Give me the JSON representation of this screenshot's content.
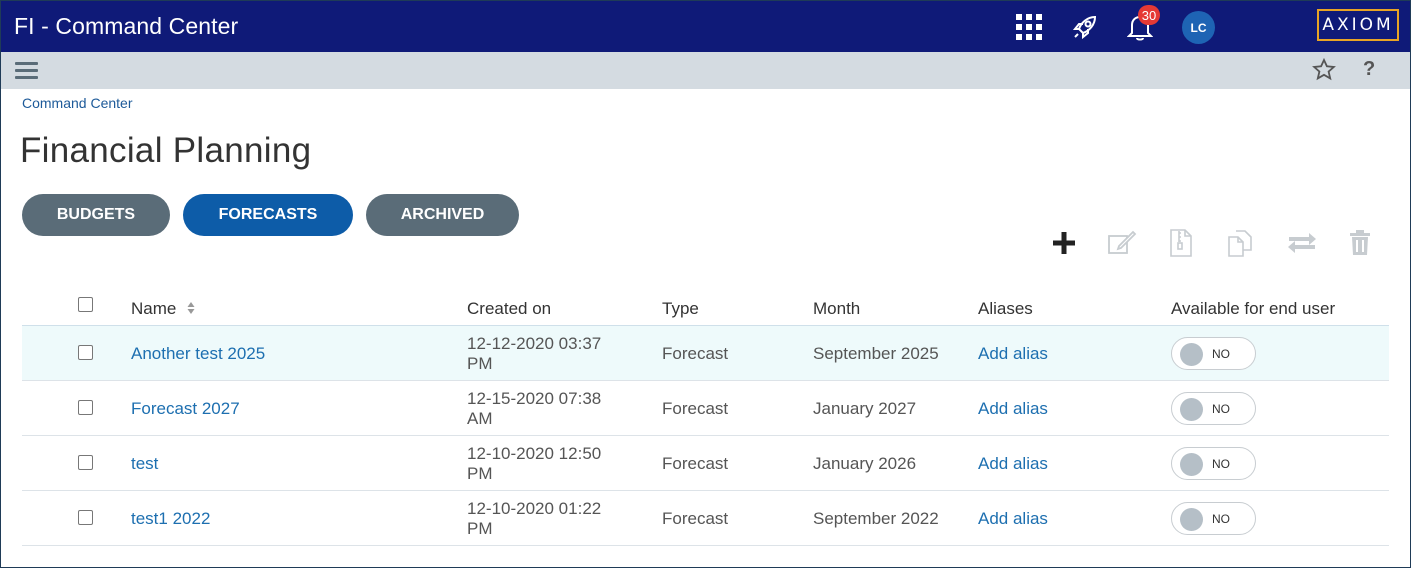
{
  "header": {
    "app_title": "FI - Command Center",
    "notification_count": "30",
    "avatar_initials": "LC",
    "logo_text": "AXIOM",
    "icons": [
      "apps-grid-icon",
      "rocket-icon",
      "bell-icon"
    ]
  },
  "subbar": {
    "icons": [
      "hamburger-menu-icon",
      "star-icon",
      "help-icon"
    ],
    "help_label": "?"
  },
  "breadcrumb": "Command Center",
  "page_title": "Financial Planning",
  "tabs": [
    {
      "label": "BUDGETS",
      "active": false
    },
    {
      "label": "FORECASTS",
      "active": true
    },
    {
      "label": "ARCHIVED",
      "active": false
    }
  ],
  "toolbar": [
    "plus-icon",
    "edit-icon",
    "file-zip-icon",
    "copy-icon",
    "swap-icon",
    "trash-icon"
  ],
  "table": {
    "columns": [
      "Name",
      "Created on",
      "Type",
      "Month",
      "Aliases",
      "Available for end user"
    ],
    "rows": [
      {
        "name": "Another test 2025",
        "created_line1": "12-12-2020 03:37",
        "created_line2": "PM",
        "type": "Forecast",
        "month": "September 2025",
        "alias": "Add alias",
        "available": "NO"
      },
      {
        "name": "Forecast 2027",
        "created_line1": "12-15-2020 07:38",
        "created_line2": "AM",
        "type": "Forecast",
        "month": "January 2027",
        "alias": "Add alias",
        "available": "NO"
      },
      {
        "name": "test",
        "created_line1": "12-10-2020 12:50",
        "created_line2": "PM",
        "type": "Forecast",
        "month": "January 2026",
        "alias": "Add alias",
        "available": "NO"
      },
      {
        "name": "test1 2022",
        "created_line1": "12-10-2020 01:22",
        "created_line2": "PM",
        "type": "Forecast",
        "month": "September 2022",
        "alias": "Add alias",
        "available": "NO"
      }
    ]
  },
  "colors": {
    "topbar": "#0f1a78",
    "subbar": "#d4dbe1",
    "tab_active": "#0d5ca8",
    "tab_inactive": "#5a6c78",
    "link": "#1d6fb0",
    "badge": "#e53935",
    "logo_border": "#e8a425"
  }
}
